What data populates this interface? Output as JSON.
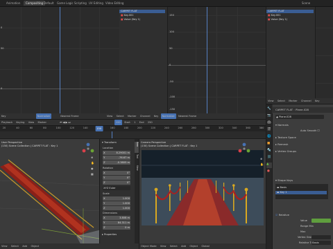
{
  "topbar": {
    "tabs": [
      "Animation",
      "Compositing",
      "Default",
      "Game Logic",
      "Scripting",
      "UV Editing",
      "Video Editing"
    ],
    "active_tab": "Compositing",
    "right_label": "Scene"
  },
  "graph_left": {
    "y_labels": [
      "0",
      "50",
      "0"
    ],
    "channels": [
      {
        "label": "CARPET FLAT",
        "selected": true
      },
      {
        "label": "Key.001",
        "selected": false
      },
      {
        "label": "Value (Key 1)",
        "selected": false
      }
    ]
  },
  "graph_mid": {
    "y_labels": [
      "150",
      "100",
      "50",
      "0",
      "-50",
      "-100",
      "-150"
    ]
  },
  "graph_right": {
    "channels": [
      {
        "label": "CARPET FLAT",
        "selected": true
      },
      {
        "label": "Key.001",
        "selected": false
      },
      {
        "label": "Value (Key 1)",
        "selected": false
      }
    ]
  },
  "graph_header": {
    "left": [
      "Key",
      "Normalize",
      "View",
      "Select",
      "Marker",
      "Channel",
      "Key",
      "Nearest Frame"
    ],
    "right": [
      "View",
      "Select",
      "Marker",
      "Channel",
      "Key",
      "Normalize",
      "Nearest Frame"
    ]
  },
  "timeline": {
    "header": [
      "Playback",
      "Keying",
      "View",
      "Marker"
    ],
    "frame_label": "150",
    "start_label": "Start",
    "start_value": "1",
    "end_label": "End",
    "end_value": "250",
    "ticks": [
      "20",
      "40",
      "60",
      "80",
      "100",
      "120",
      "140",
      "150",
      "160",
      "180",
      "200",
      "220",
      "240",
      "260",
      "280",
      "300",
      "320",
      "340",
      "360",
      "380"
    ]
  },
  "viewport_left": {
    "title": "User Perspective",
    "subtitle": "(150) Scene Collection | CARPET FLAT : Key 1",
    "menu": [
      "View",
      "Select",
      "Add",
      "Object"
    ]
  },
  "n_panel": {
    "transform": "Transform",
    "location": "Location",
    "loc": [
      {
        "axis": "X",
        "value": "8.29001 m"
      },
      {
        "axis": "Y",
        "value": "-76.67 m"
      },
      {
        "axis": "Z",
        "value": "-0.3805 m"
      }
    ],
    "rotation": "Rotation",
    "rot": [
      {
        "axis": "X",
        "value": "0°"
      },
      {
        "axis": "Y",
        "value": "0°"
      },
      {
        "axis": "Z",
        "value": "0°"
      }
    ],
    "rot_mode": "XYZ Euler",
    "scale": "Scale",
    "scl": [
      {
        "axis": "X",
        "value": "1.000"
      },
      {
        "axis": "Y",
        "value": "1.000"
      },
      {
        "axis": "Z",
        "value": "1.000"
      }
    ],
    "dimensions": "Dimensions",
    "dim": [
      {
        "axis": "X",
        "value": "3.808 m"
      },
      {
        "axis": "Y",
        "value": "84.311 m"
      },
      {
        "axis": "Z",
        "value": "0 m"
      }
    ],
    "properties": "Properties",
    "tabs": [
      "Item",
      "Tool",
      "View"
    ]
  },
  "viewport_camera": {
    "title": "Camera Perspective",
    "subtitle": "(150) Scene Collection | CARPET FLAT : Key 1",
    "menu": [
      "Object Mode",
      "View",
      "Select",
      "Add",
      "Object",
      "Global"
    ]
  },
  "properties": {
    "header": [
      "View",
      "Select",
      "Marker",
      "Channel",
      "Key"
    ],
    "object_name": "CARPET FLAT",
    "mesh_name": "Plane.028",
    "sections": [
      "Normals",
      "Auto Smooth",
      "Texture Space",
      "Remesh",
      "Vertex Groups",
      "Shape Keys"
    ],
    "shape_keys": [
      "Basis",
      "Key 1"
    ],
    "relative": "Relative",
    "value_label": "Value",
    "range_min_label": "Range Min",
    "max_label": "Max",
    "vertex_group_label": "Vertex Group",
    "relative_to_label": "Relative To",
    "relative_to_value": "Basis",
    "accent": "#4772b3"
  }
}
